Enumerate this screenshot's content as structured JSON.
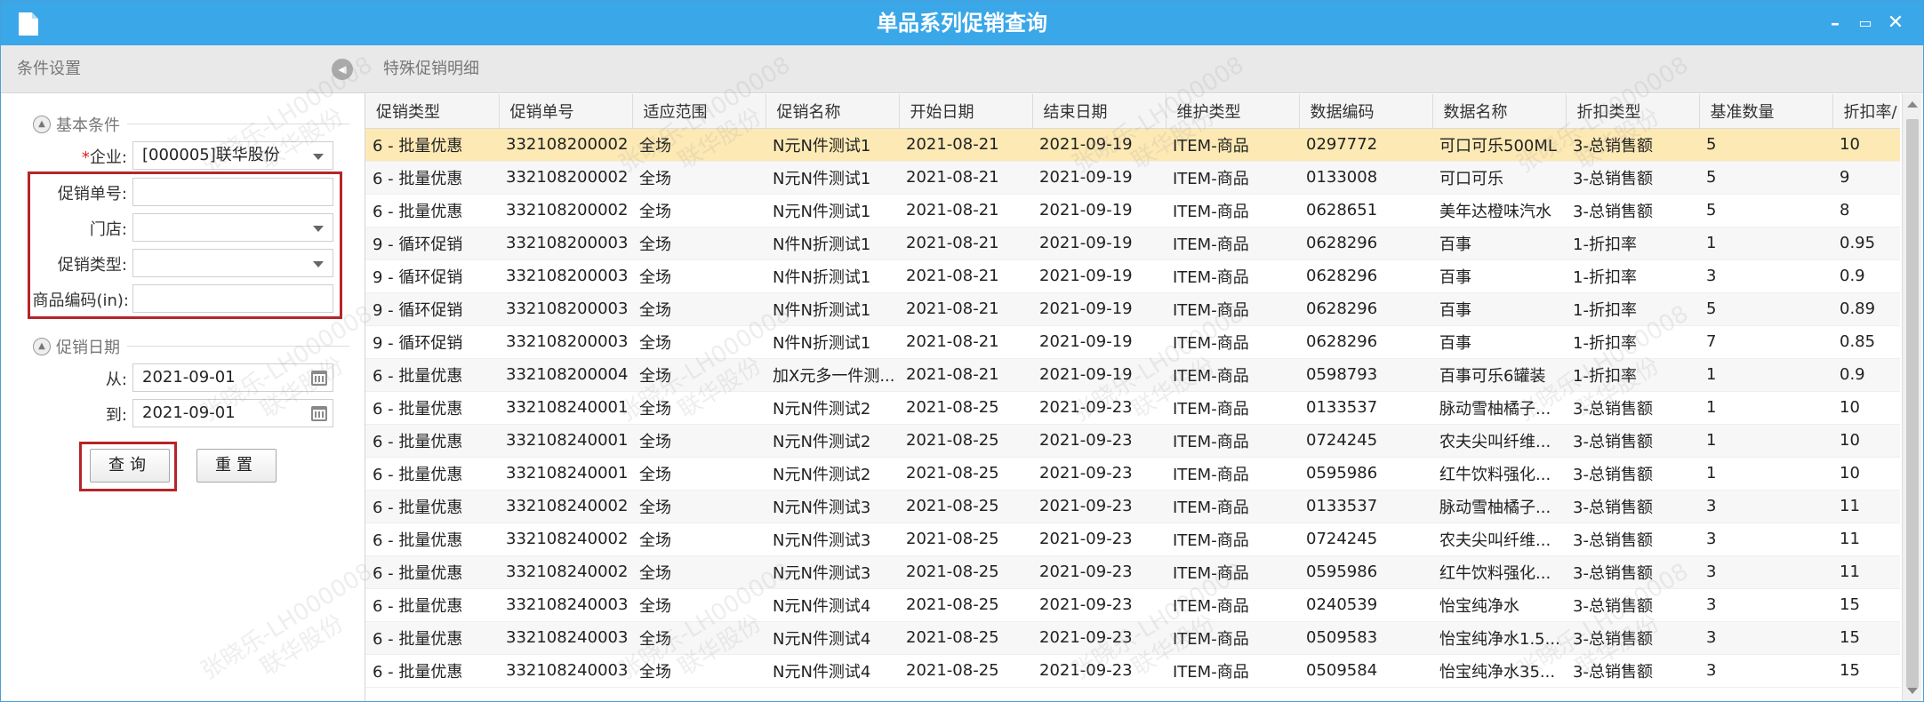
{
  "window": {
    "title": "单品系列促销查询",
    "controls": {
      "minimize": "–",
      "restore": "▭",
      "close": "✕"
    }
  },
  "left_panel": {
    "header": "条件设置",
    "basic_group": "基本条件",
    "fields": {
      "company": {
        "label": "企业:",
        "required_mark": "*",
        "value": "[000005]联华股份"
      },
      "promo_no": {
        "label": "促销单号:",
        "value": ""
      },
      "store": {
        "label": "门店:",
        "value": ""
      },
      "promo_type": {
        "label": "促销类型:",
        "value": ""
      },
      "item_code": {
        "label": "商品编码(in):",
        "value": ""
      }
    },
    "date_group": "促销日期",
    "date_from": {
      "label": "从:",
      "value": "2021-09-01"
    },
    "date_to": {
      "label": "到:",
      "value": "2021-09-01"
    },
    "buttons": {
      "query": "查询",
      "reset": "重置"
    }
  },
  "right_panel": {
    "header": "特殊促销明细",
    "columns": [
      "促销类型",
      "促销单号",
      "适应范围",
      "促销名称",
      "开始日期",
      "结束日期",
      "维护类型",
      "数据编码",
      "数据名称",
      "折扣类型",
      "基准数量",
      "折扣率/"
    ],
    "rows": [
      [
        "6 - 批量优惠",
        "332108200002",
        "全场",
        "N元N件测试1",
        "2021-08-21",
        "2021-09-19",
        "ITEM-商品",
        "0297772",
        "可口可乐500ML",
        "3-总销售额",
        "5",
        "10"
      ],
      [
        "6 - 批量优惠",
        "332108200002",
        "全场",
        "N元N件测试1",
        "2021-08-21",
        "2021-09-19",
        "ITEM-商品",
        "0133008",
        "可口可乐",
        "3-总销售额",
        "5",
        "9"
      ],
      [
        "6 - 批量优惠",
        "332108200002",
        "全场",
        "N元N件测试1",
        "2021-08-21",
        "2021-09-19",
        "ITEM-商品",
        "0628651",
        "美年达橙味汽水",
        "3-总销售额",
        "5",
        "8"
      ],
      [
        "9 - 循环促销",
        "332108200003",
        "全场",
        "N件N折测试1",
        "2021-08-21",
        "2021-09-19",
        "ITEM-商品",
        "0628296",
        "百事",
        "1-折扣率",
        "1",
        "0.95"
      ],
      [
        "9 - 循环促销",
        "332108200003",
        "全场",
        "N件N折测试1",
        "2021-08-21",
        "2021-09-19",
        "ITEM-商品",
        "0628296",
        "百事",
        "1-折扣率",
        "3",
        "0.9"
      ],
      [
        "9 - 循环促销",
        "332108200003",
        "全场",
        "N件N折测试1",
        "2021-08-21",
        "2021-09-19",
        "ITEM-商品",
        "0628296",
        "百事",
        "1-折扣率",
        "5",
        "0.89"
      ],
      [
        "9 - 循环促销",
        "332108200003",
        "全场",
        "N件N折测试1",
        "2021-08-21",
        "2021-09-19",
        "ITEM-商品",
        "0628296",
        "百事",
        "1-折扣率",
        "7",
        "0.85"
      ],
      [
        "6 - 批量优惠",
        "332108200004",
        "全场",
        "加X元多一件测...",
        "2021-08-21",
        "2021-09-19",
        "ITEM-商品",
        "0598793",
        "百事可乐6罐装",
        "1-折扣率",
        "1",
        "0.9"
      ],
      [
        "6 - 批量优惠",
        "332108240001",
        "全场",
        "N元N件测试2",
        "2021-08-25",
        "2021-09-23",
        "ITEM-商品",
        "0133537",
        "脉动雪柚橘子...",
        "3-总销售额",
        "1",
        "10"
      ],
      [
        "6 - 批量优惠",
        "332108240001",
        "全场",
        "N元N件测试2",
        "2021-08-25",
        "2021-09-23",
        "ITEM-商品",
        "0724245",
        "农夫尖叫纤维...",
        "3-总销售额",
        "1",
        "10"
      ],
      [
        "6 - 批量优惠",
        "332108240001",
        "全场",
        "N元N件测试2",
        "2021-08-25",
        "2021-09-23",
        "ITEM-商品",
        "0595986",
        "红牛饮料强化...",
        "3-总销售额",
        "1",
        "10"
      ],
      [
        "6 - 批量优惠",
        "332108240002",
        "全场",
        "N元N件测试3",
        "2021-08-25",
        "2021-09-23",
        "ITEM-商品",
        "0133537",
        "脉动雪柚橘子...",
        "3-总销售额",
        "3",
        "11"
      ],
      [
        "6 - 批量优惠",
        "332108240002",
        "全场",
        "N元N件测试3",
        "2021-08-25",
        "2021-09-23",
        "ITEM-商品",
        "0724245",
        "农夫尖叫纤维...",
        "3-总销售额",
        "3",
        "11"
      ],
      [
        "6 - 批量优惠",
        "332108240002",
        "全场",
        "N元N件测试3",
        "2021-08-25",
        "2021-09-23",
        "ITEM-商品",
        "0595986",
        "红牛饮料强化...",
        "3-总销售额",
        "3",
        "11"
      ],
      [
        "6 - 批量优惠",
        "332108240003",
        "全场",
        "N元N件测试4",
        "2021-08-25",
        "2021-09-23",
        "ITEM-商品",
        "0240539",
        "怡宝纯净水",
        "3-总销售额",
        "3",
        "15"
      ],
      [
        "6 - 批量优惠",
        "332108240003",
        "全场",
        "N元N件测试4",
        "2021-08-25",
        "2021-09-23",
        "ITEM-商品",
        "0509583",
        "怡宝纯净水1.5...",
        "3-总销售额",
        "3",
        "15"
      ],
      [
        "6 - 批量优惠",
        "332108240003",
        "全场",
        "N元N件测试4",
        "2021-08-25",
        "2021-09-23",
        "ITEM-商品",
        "0509584",
        "怡宝纯净水35...",
        "3-总销售额",
        "3",
        "15"
      ]
    ],
    "selected_row": 0
  },
  "watermark": {
    "line1": "张晓乐-LH000008",
    "line2": "联华股份"
  },
  "colors": {
    "titlebar": "#3aa7e8",
    "selected_row": "#fde9b4",
    "highlight_border": "#b5252a"
  }
}
